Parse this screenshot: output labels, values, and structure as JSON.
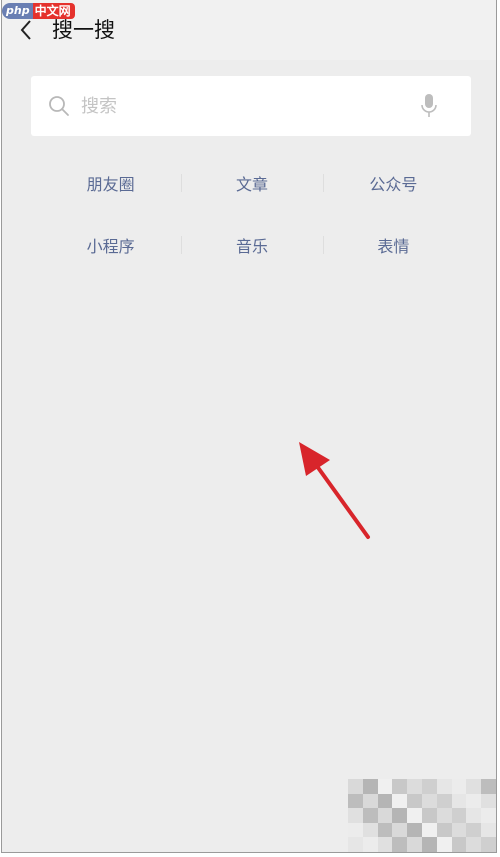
{
  "watermark": {
    "badge": "php",
    "text": "中文网"
  },
  "header": {
    "back_icon": "chevron-left-icon",
    "title": "搜一搜"
  },
  "search": {
    "placeholder": "搜索",
    "value": "",
    "search_icon": "search-icon",
    "mic_icon": "microphone-icon"
  },
  "categories": [
    {
      "label": "朋友圈"
    },
    {
      "label": "文章"
    },
    {
      "label": "公众号"
    },
    {
      "label": "小程序"
    },
    {
      "label": "音乐"
    },
    {
      "label": "表情"
    }
  ],
  "colors": {
    "background": "#ededed",
    "category_text": "#5a6a94",
    "annotation_arrow": "#d8252b",
    "watermark_red": "#e5322d",
    "watermark_blue": "#6a7fb3"
  }
}
